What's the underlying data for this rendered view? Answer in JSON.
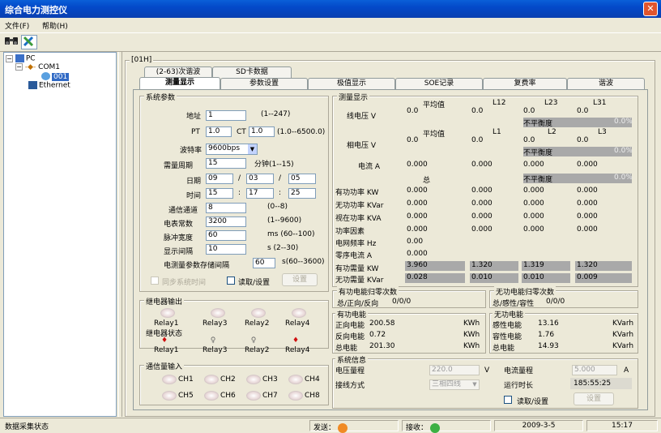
{
  "window": {
    "title": "综合电力测控仪",
    "close": "✕"
  },
  "menu": [
    "文件(F)",
    "帮助(H)"
  ],
  "toolbar": {
    "icons": [
      "binoculars-icon",
      "tools-icon"
    ]
  },
  "tree": {
    "root": "PC",
    "port": "COM1",
    "device": "001",
    "ethernet": "Ethernet"
  },
  "panel": {
    "frame_label": "[01H]"
  },
  "tabs_row1": [
    "(2-63)次谐波",
    "SD卡数据"
  ],
  "tabs_row2": [
    "测量显示",
    "参数设置",
    "极值显示",
    "SOE记录",
    "复费率",
    "谐波"
  ],
  "sys": {
    "title": "系统参数",
    "addr_label": "地址",
    "addr": "1",
    "addr_range": "(1--247)",
    "pt_label": "PT",
    "pt": "1.0",
    "ct_label": "CT",
    "ct": "1.0",
    "ptct_range": "(1.0--6500.0)",
    "baud_label": "波特率",
    "baud": "9600bps",
    "demand_label": "需量周期",
    "demand": "15",
    "demand_unit": "分钟(1--15)",
    "date_label": "日期",
    "date_y": "09",
    "date_m": "03",
    "date_d": "05",
    "slash": "/",
    "time_label": "时间",
    "time_h": "15",
    "time_m": "17",
    "time_s": "25",
    "colon": ":",
    "chan_label": "通信通道",
    "chan": "8",
    "chan_range": "(0--8)",
    "meter_label": "电表常数",
    "meter": "3200",
    "meter_range": "(1--9600)",
    "pulse_label": "脉冲宽度",
    "pulse": "60",
    "pulse_range": "ms (60--100)",
    "disp_label": "显示间隔",
    "disp": "10",
    "disp_range": "s (2--30)",
    "store_label": "电测量参数存储间隔",
    "store": "60",
    "store_range": "s(60--3600)",
    "sync_label": "同步系统时间",
    "rw_label": "读取/设置",
    "set_btn": "设置"
  },
  "relay_out": {
    "title": "继电器输出",
    "labels": [
      "Relay1",
      "Relay3",
      "Relay2",
      "Relay4"
    ]
  },
  "relay_state": {
    "title": "继电器状态",
    "labels": [
      "Relay1",
      "Relay3",
      "Relay2",
      "Relay4"
    ]
  },
  "comm_in": {
    "title": "通信量输入",
    "labels": [
      "CH1",
      "CH2",
      "CH3",
      "CH4",
      "CH5",
      "CH6",
      "CH7",
      "CH8"
    ]
  },
  "meas": {
    "title": "测量显示",
    "h_avg": "平均值",
    "h_l12": "L12",
    "h_l23": "L23",
    "h_l31": "L31",
    "line_v_label": "线电压 V",
    "line_v": [
      "0.0",
      "0.0",
      "0.0",
      "0.0"
    ],
    "unbalance": "不平衡度",
    "unb_val": "0.0%",
    "h_avg2": "平均值",
    "h_l1": "L1",
    "h_l2": "L2",
    "h_l3": "L3",
    "phase_v_label": "相电压 V",
    "phase_v": [
      "0.0",
      "0.0",
      "0.0",
      "0.0"
    ],
    "current_label": "电流 A",
    "current": [
      "0.000",
      "0.000",
      "0.000",
      "0.000"
    ],
    "h_total": "总",
    "rows": [
      {
        "label": "有功功率 KW",
        "v": [
          "0.000",
          "0.000",
          "0.000",
          "0.000"
        ]
      },
      {
        "label": "无功功率 KVar",
        "v": [
          "0.000",
          "0.000",
          "0.000",
          "0.000"
        ]
      },
      {
        "label": "视在功率 KVA",
        "v": [
          "0.000",
          "0.000",
          "0.000",
          "0.000"
        ]
      },
      {
        "label": "功率因素",
        "v": [
          "0.000",
          "0.000",
          "0.000",
          "0.000"
        ]
      }
    ],
    "freq_label": "电网频率 Hz",
    "freq": "0.00",
    "zero_label": "零序电流 A",
    "zero": "0.000",
    "demand_p_label": "有功需量 KW",
    "demand_p": [
      "3.960",
      "1.320",
      "1.319",
      "1.320"
    ],
    "demand_q_label": "无功需量 KVar",
    "demand_q": [
      "0.028",
      "0.010",
      "0.010",
      "0.009"
    ]
  },
  "energy": {
    "p_reset_title": "有功电能归零次数",
    "p_reset_label": "总/正向/反向",
    "p_reset": "0/0/0",
    "q_reset_title": "无功电能归零次数",
    "q_reset_label": "总/感性/容性",
    "q_reset": "0/0/0",
    "p_title": "有功电能",
    "p_rows": [
      {
        "label": "正向电能",
        "v": "200.58",
        "u": "KWh"
      },
      {
        "label": "反向电能",
        "v": "0.72",
        "u": "KWh"
      },
      {
        "label": "总电能",
        "v": "201.30",
        "u": "KWh"
      }
    ],
    "q_title": "无功电能",
    "q_rows": [
      {
        "label": "感性电能",
        "v": "13.16",
        "u": "KVarh"
      },
      {
        "label": "容性电能",
        "v": "1.76",
        "u": "KVarh"
      },
      {
        "label": "总电能",
        "v": "14.93",
        "u": "KVarh"
      }
    ]
  },
  "sysinfo": {
    "title": "系统信息",
    "vrange_label": "电压量程",
    "vrange": "220.0",
    "vunit": "V",
    "irange_label": "电流量程",
    "irange": "5.000",
    "iunit": "A",
    "wiring_label": "接线方式",
    "wiring": "三相四线",
    "runtime_label": "运行时长",
    "runtime": "185:55:25",
    "rw_label": "读取/设置",
    "set_btn": "设置"
  },
  "status": {
    "text": "数据采集状态",
    "send": "发送：",
    "recv": "接收：",
    "date": "2009-3-5",
    "time": "15:17"
  },
  "colors": {
    "send": "#f08a24",
    "recv": "#3cb043",
    "led_on": "#d01010"
  }
}
